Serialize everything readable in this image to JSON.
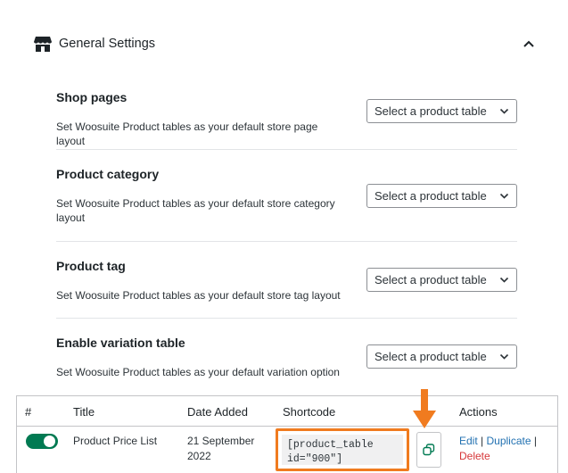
{
  "general_settings": {
    "title": "General Settings",
    "icon": "store-icon",
    "collapse_icon": "chevron-up-icon"
  },
  "settings": [
    {
      "label": "Shop pages",
      "description": "Set Woosuite Product tables as your default store page layout",
      "select_value": "Select a product table"
    },
    {
      "label": "Product category",
      "description": "Set Woosuite Product tables as your default store category layout",
      "select_value": "Select a product table"
    },
    {
      "label": "Product tag",
      "description": "Set Woosuite Product tables as your default store tag layout",
      "select_value": "Select a product table"
    },
    {
      "label": "Enable variation table",
      "description": "Set Woosuite Product tables as your default variation option",
      "select_value": "Select a product table"
    }
  ],
  "table": {
    "headers": [
      "#",
      "Title",
      "Date Added",
      "Shortcode",
      "Actions"
    ],
    "rows": [
      {
        "enabled": true,
        "title": "Product Price List",
        "date_added": "21 September 2022",
        "shortcode": "[product_table id=\"900\"]",
        "actions": {
          "edit": "Edit",
          "separator": "|",
          "duplicate": "Duplicate",
          "delete": "Delete"
        }
      }
    ]
  },
  "colors": {
    "toggle_on": "#007a52",
    "highlight": "#f07b1f",
    "link": "#2271b1",
    "delete": "#d63638"
  }
}
